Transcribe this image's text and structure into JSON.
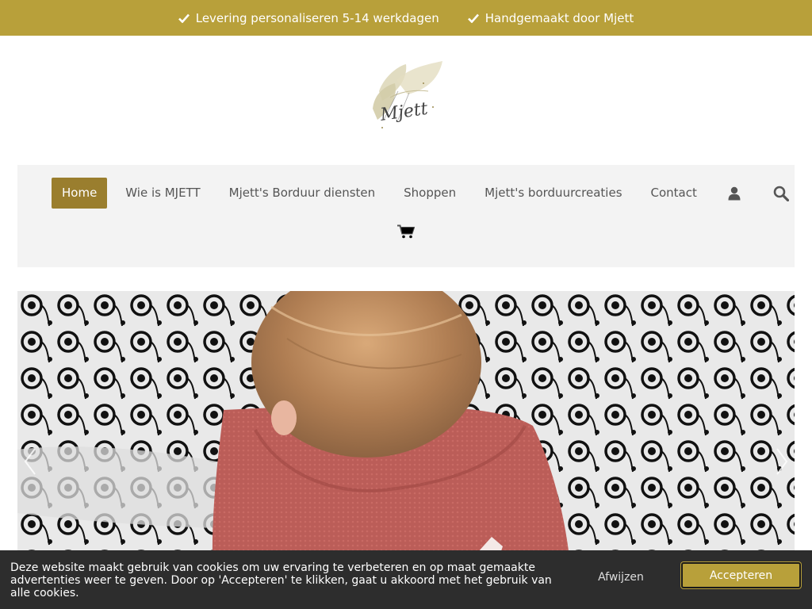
{
  "topbar": {
    "usps": [
      {
        "icon": "check-icon",
        "text": "Levering personaliseren 5-14 werkdagen"
      },
      {
        "icon": "check-icon",
        "text": "Handgemaakt door Mjett"
      }
    ]
  },
  "logo": {
    "text": "Mjett"
  },
  "nav": {
    "items": [
      {
        "label": "Home",
        "active": true
      },
      {
        "label": "Wie is MJETT"
      },
      {
        "label": "Mjett's Borduur diensten"
      },
      {
        "label": "Shoppen"
      },
      {
        "label": "Mjett's borduurcreaties"
      },
      {
        "label": "Contact"
      }
    ],
    "icons": [
      "user-icon",
      "search-icon",
      "cart-icon"
    ]
  },
  "hero": {
    "image": "child-in-pink-towel-on-patterned-blanket"
  },
  "cookie": {
    "message": "Deze website maakt gebruik van cookies om uw ervaring te verbeteren en op maat gemaakte advertenties weer te geven.  Door op 'Accepteren' te klikken, gaat u akkoord met het gebruik van alle cookies.",
    "reject_label": "Afwijzen",
    "accept_label": "Accepteren"
  },
  "colors": {
    "accent": "#b8a03a",
    "nav_active": "#9a7e2e",
    "cookie_bg": "#2d2d2d"
  }
}
